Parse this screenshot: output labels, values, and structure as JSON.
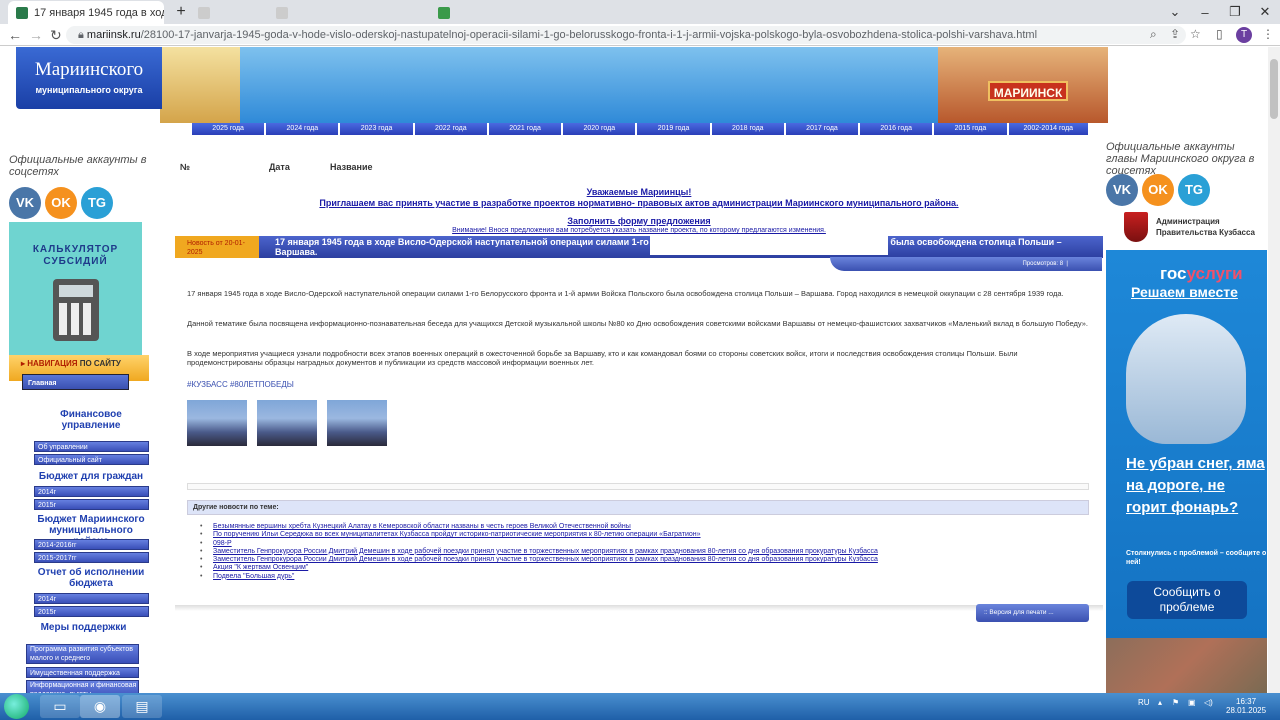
{
  "browser": {
    "tabs": [
      {
        "title": "17 января 1945 года в ходе Вис",
        "active": true
      },
      {
        "title": "",
        "active": false
      },
      {
        "title": "",
        "active": false
      },
      {
        "title": "",
        "active": false
      }
    ],
    "new_tab_symbol": "+",
    "url_domain": "mariinsk.ru",
    "url_path": "/28100-17-janvarja-1945-goda-v-hode-vislo-oderskoj-nastupatelnoj-operacii-silami-1-go-belorusskogo-fronta-i-1-j-armii-vojska-polskogo-byla-osvobozhdena-stolica-polshi-varshava.html",
    "avatar_letter": "T"
  },
  "site": {
    "logo_line1": "Мариинского",
    "logo_line2": "муниципального округа",
    "banner_sign": "МАРИИНСК",
    "years": [
      "2025 года",
      "2024 года",
      "2023 года",
      "2022 года",
      "2021 года",
      "2020 года",
      "2019 года",
      "2018 года",
      "2017 года",
      "2016 года",
      "2015 года",
      "2002-2014 года"
    ]
  },
  "left": {
    "social_title": "Официальные аккаунты в соцсетях",
    "social": {
      "vk": "VK",
      "ok": "OK",
      "tg": "TG"
    },
    "calc_title": "КАЛЬКУЛЯТОР СУБСИДИЙ",
    "nav_header_a": "НАВИГАЦИЯ",
    "nav_header_b": "ПО САЙТУ",
    "home": "Главная",
    "sec_fin": "Финансовое управление",
    "btn_about": "Об управлении",
    "btn_official": "Официальный сайт",
    "sec_budget": "Бюджет для граждан",
    "btn_2014": "2014г",
    "btn_2015": "2015г",
    "sec_budget_m": "Бюджет Мариинского муниципального района",
    "btn_2014_2016": "2014-2016гг",
    "btn_2015_2017": "2015-2017гг",
    "sec_report": "Отчет об исполнении бюджета",
    "btn_r2014": "2014г",
    "btn_r2015": "2015г",
    "sec_support": "Меры поддержки",
    "btn_program": "Программа развития субъектов малого и среднего предпринимательства",
    "btn_property": "Имущественная поддержка",
    "btn_info": "Информационная и финансовая поддержка, льготы"
  },
  "content": {
    "col_no": "№",
    "col_date": "Дата",
    "col_name": "Название",
    "notice_title": "Уважаемые Мариинцы!",
    "notice_text": "Приглашаем вас принять участие в разработке проектов нормативно- правовых актов администрации Мариинского муниципального района.",
    "notice_link": "Заполнить форму предложения",
    "notice_small": "Внимание! Внося предложения вам потребуется указать название проекта, по которому предлагаются изменения.",
    "news_date": "Новость от  20-01-2025",
    "news_title": "17 января 1945 года в ходе Висло-Одерской наступательной операции силами 1-го Белорусского фронта и 1-й армии Войска Польского была освобождена столица Польши – Варшава.",
    "views_label": "Просмотров: 8",
    "p1": "17 января 1945 года в ходе Висло-Одерской наступательной операции силами 1-го Белорусского фронта и 1-й армии Войска Польского была освобождена столица Польши – Варшава. Город находился в немецкой оккупации с 28 сентября 1939 года.",
    "p2": "Данной тематике была посвящена информационно-познавательная беседа для учащихся Детской музыкальной школы №80 ко Дню освобождения советскими войсками Варшавы от немецко-фашистских захватчиков «Маленький вклад в большую Победу».",
    "p3": "В ходе мероприятия учащиеся узнали подробности всех этапов военных операций в ожесточенной борьбе за Варшаву, кто и как командовал боями со стороны советских войск, итоги и последствия освобождения столицы Польши. Были продемонстрированы образцы наградных документов и публикации из средств массовой информации военных лет.",
    "tags": "#КУЗБАСС #80ЛЕТПОБЕДЫ",
    "other_title": "Другие новости по теме:",
    "other_news": [
      "Безымянные вершины хребта Кузнецкий Алатау в Кемеровской области названы в честь героев Великой Отечественной войны",
      "По поручению Ильи Середюка во всех муниципалитетах Кузбасса пройдут историко-патриотические мероприятия к 80-летию операции «Багратион»",
      "098-Р",
      "Заместитель Генпрокурора России Дмитрий Демешин в ходе рабочей поездки принял участие в торжественных мероприятиях в рамках празднования 80-летия со дня образования прокуратуры Кузбасса",
      "Заместитель Генпрокурора России Дмитрий Демешин в ходе рабочей поездки принял участие в торжественных мероприятиях в рамках празднования 80-летия со дня образования прокуратуры Кузбасса",
      "Акция \"К жертвам Освенцим\"",
      "Подвела \"Большая дурь\""
    ],
    "print_label": "::  Версия для печати ..."
  },
  "right": {
    "social_title": "Официальные аккаунты главы Мариинского округа в соцсетях",
    "social": {
      "vk": "VK",
      "ok": "OK",
      "tg": "TG"
    },
    "adm_text": "Администрация Правительства Кузбасса",
    "gos_a": "гос",
    "gos_b": "услуги",
    "gos_slogan": "Решаем вместе",
    "gos_question": "Не убран снег, яма на дороге, не горит фонарь?",
    "gos_sub": "Столкнулись с проблемой – сообщите о ней!",
    "gos_button": "Сообщить о проблеме"
  },
  "taskbar": {
    "lang": "RU",
    "time": "16:37",
    "date": "28.01.2025"
  }
}
